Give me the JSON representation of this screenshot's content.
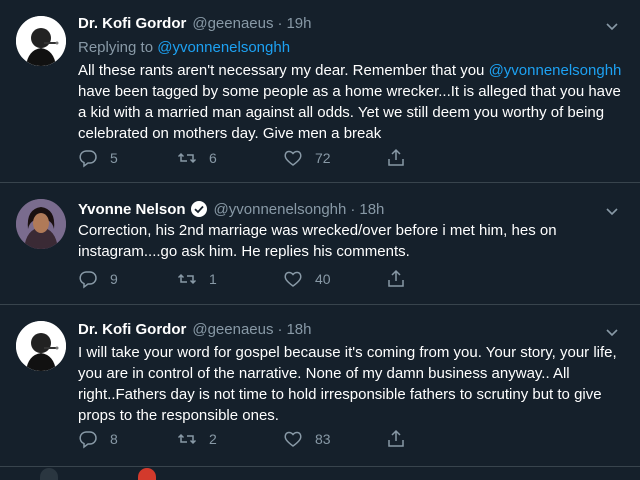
{
  "tweets": [
    {
      "name": "Dr. Kofi Gordor",
      "handle": "@geenaeus",
      "dot": "·",
      "time": "19h",
      "replying_label": "Replying to",
      "replying_handle": "@yvonnenelsonghh",
      "text_pre": "All these rants aren't necessary my dear. Remember that you ",
      "text_mention": "@yvonnenelsonghh",
      "text_post": " have been tagged by some people as a home wrecker...It is alleged that you have a kid with a married man against all odds. Yet we still deem you worthy of being celebrated on mothers day. Give men a break",
      "replies": "5",
      "retweets": "6",
      "likes": "72",
      "avatar_icon": "man-with-cigar-avatar"
    },
    {
      "name": "Yvonne Nelson",
      "verified_icon": "verified-badge-icon",
      "handle": "@yvonnenelsonghh",
      "dot": "·",
      "time": "18h",
      "text": "Correction, his 2nd marriage was wrecked/over before i met him, hes on instagram....go ask him. He replies his comments.",
      "replies": "9",
      "retweets": "1",
      "likes": "40",
      "avatar_icon": "woman-portrait-avatar"
    },
    {
      "name": "Dr. Kofi Gordor",
      "handle": "@geenaeus",
      "dot": "·",
      "time": "18h",
      "text": "I will take your word for gospel because it's coming from you. Your story, your life, you are in control of the narrative. None of my damn business anyway.. All right..Fathers day is not time to hold irresponsible fathers to scrutiny but to give props to the responsible ones.",
      "replies": "8",
      "retweets": "2",
      "likes": "83",
      "avatar_icon": "man-with-cigar-avatar"
    }
  ],
  "colors": {
    "background": "#15202b",
    "text": "#ffffff",
    "muted": "#8899a6",
    "link": "#1da1f2",
    "divider": "#38444d"
  }
}
